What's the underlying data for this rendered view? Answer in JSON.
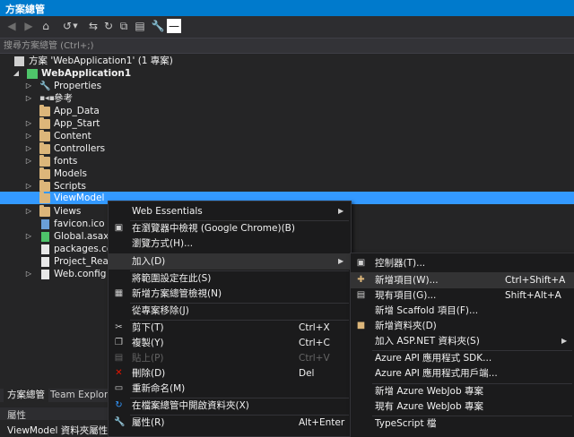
{
  "panel": {
    "title": "方案總管"
  },
  "search": {
    "placeholder": "搜尋方案總管 (Ctrl+;)"
  },
  "tree": {
    "solution": "方案 'WebApplication1' (1 專案)",
    "project": "WebApplication1",
    "items": [
      "Properties",
      "參考",
      "App_Data",
      "App_Start",
      "Content",
      "Controllers",
      "fonts",
      "Models",
      "Scripts",
      "ViewModel",
      "Views",
      "favicon.ico",
      "Global.asax",
      "packages.con",
      "Project_Readr",
      "Web.config"
    ]
  },
  "bottom_tabs": [
    "方案總管",
    "Team Explorer"
  ],
  "properties": {
    "title": "屬性",
    "row": "ViewModel 資料夾屬性"
  },
  "context_menu": {
    "items": [
      {
        "label": "Web Essentials",
        "shortcut": ""
      },
      {
        "label": "在瀏覽器中檢視 (Google Chrome)(B)",
        "shortcut": ""
      },
      {
        "label": "瀏覽方式(H)...",
        "shortcut": ""
      },
      {
        "label": "加入(D)",
        "shortcut": ""
      },
      {
        "label": "將範圍設定在此(S)",
        "shortcut": ""
      },
      {
        "label": "新增方案總管檢視(N)",
        "shortcut": ""
      },
      {
        "label": "從專案移除(J)",
        "shortcut": ""
      },
      {
        "label": "剪下(T)",
        "shortcut": "Ctrl+X"
      },
      {
        "label": "複製(Y)",
        "shortcut": "Ctrl+C"
      },
      {
        "label": "貼上(P)",
        "shortcut": "Ctrl+V"
      },
      {
        "label": "刪除(D)",
        "shortcut": "Del"
      },
      {
        "label": "重新命名(M)",
        "shortcut": ""
      },
      {
        "label": "在檔案總管中開啟資料夾(X)",
        "shortcut": ""
      },
      {
        "label": "屬性(R)",
        "shortcut": "Alt+Enter"
      }
    ]
  },
  "submenu": {
    "items": [
      {
        "label": "控制器(T)...",
        "shortcut": ""
      },
      {
        "label": "新增項目(W)...",
        "shortcut": "Ctrl+Shift+A"
      },
      {
        "label": "現有項目(G)...",
        "shortcut": "Shift+Alt+A"
      },
      {
        "label": "新增 Scaffold 項目(F)...",
        "shortcut": ""
      },
      {
        "label": "新增資料夾(D)",
        "shortcut": ""
      },
      {
        "label": "加入 ASP.NET 資料夾(S)",
        "shortcut": ""
      },
      {
        "label": "Azure API 應用程式 SDK...",
        "shortcut": ""
      },
      {
        "label": "Azure API 應用程式用戶端...",
        "shortcut": ""
      },
      {
        "label": "新增 Azure WebJob 專案",
        "shortcut": ""
      },
      {
        "label": "現有 Azure WebJob 專案",
        "shortcut": ""
      },
      {
        "label": "TypeScript 檔",
        "shortcut": ""
      }
    ]
  },
  "colors": {
    "accent": "#007acc",
    "selection": "#3399ff",
    "folder": "#dcb67a",
    "delete": "#e51400"
  }
}
